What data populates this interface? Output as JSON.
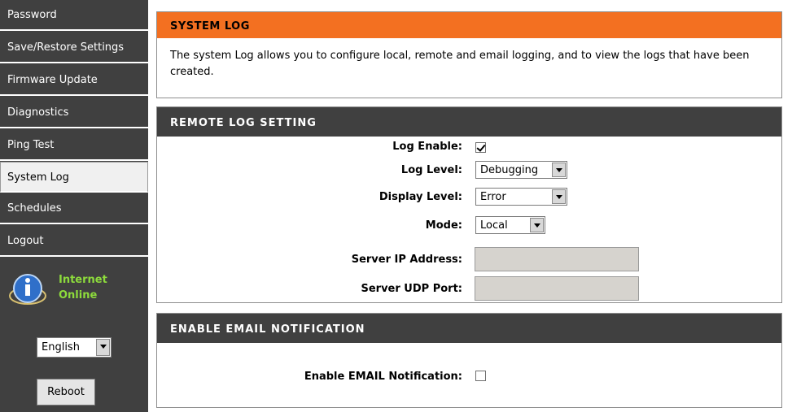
{
  "sidebar": {
    "items": [
      {
        "label": "Password"
      },
      {
        "label": "Save/Restore Settings"
      },
      {
        "label": "Firmware Update"
      },
      {
        "label": "Diagnostics"
      },
      {
        "label": "Ping Test"
      },
      {
        "label": "System Log"
      },
      {
        "label": "Schedules"
      },
      {
        "label": "Logout"
      }
    ],
    "active_item": "System Log",
    "status": {
      "line1": "Internet",
      "line2": "Online",
      "icon": "info-icon",
      "color": "#8ddb3c"
    },
    "language": {
      "selected": "English"
    },
    "reboot_label": "Reboot"
  },
  "system_log": {
    "title": "SYSTEM LOG",
    "description": "The system Log allows you to configure local, remote and email logging, and to view the logs that have been created."
  },
  "remote_log": {
    "title": "REMOTE LOG SETTING",
    "log_enable_label": "Log Enable:",
    "log_enable_checked": true,
    "log_level_label": "Log Level:",
    "log_level_value": "Debugging",
    "display_level_label": "Display Level:",
    "display_level_value": "Error",
    "mode_label": "Mode:",
    "mode_value": "Local",
    "server_ip_label": "Server IP Address:",
    "server_ip_value": "",
    "server_port_label": "Server UDP Port:",
    "server_port_value": ""
  },
  "email": {
    "title": "ENABLE EMAIL NOTIFICATION",
    "enable_label": "Enable EMAIL Notification:",
    "enable_checked": false
  },
  "colors": {
    "sidebar_bg": "#404040",
    "header_orange": "#f37021",
    "header_dark": "#404040"
  }
}
